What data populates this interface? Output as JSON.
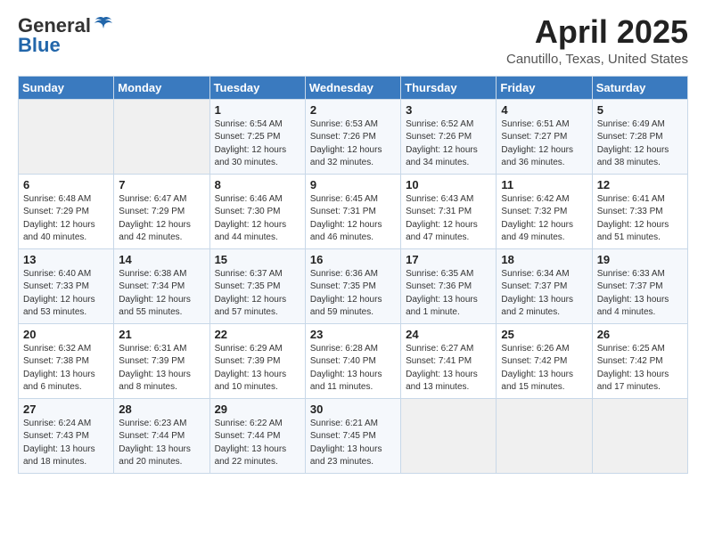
{
  "logo": {
    "line1": "General",
    "line2": "Blue"
  },
  "header": {
    "month": "April 2025",
    "location": "Canutillo, Texas, United States"
  },
  "weekdays": [
    "Sunday",
    "Monday",
    "Tuesday",
    "Wednesday",
    "Thursday",
    "Friday",
    "Saturday"
  ],
  "weeks": [
    [
      {
        "day": "",
        "info": ""
      },
      {
        "day": "",
        "info": ""
      },
      {
        "day": "1",
        "info": "Sunrise: 6:54 AM\nSunset: 7:25 PM\nDaylight: 12 hours and 30 minutes."
      },
      {
        "day": "2",
        "info": "Sunrise: 6:53 AM\nSunset: 7:26 PM\nDaylight: 12 hours and 32 minutes."
      },
      {
        "day": "3",
        "info": "Sunrise: 6:52 AM\nSunset: 7:26 PM\nDaylight: 12 hours and 34 minutes."
      },
      {
        "day": "4",
        "info": "Sunrise: 6:51 AM\nSunset: 7:27 PM\nDaylight: 12 hours and 36 minutes."
      },
      {
        "day": "5",
        "info": "Sunrise: 6:49 AM\nSunset: 7:28 PM\nDaylight: 12 hours and 38 minutes."
      }
    ],
    [
      {
        "day": "6",
        "info": "Sunrise: 6:48 AM\nSunset: 7:29 PM\nDaylight: 12 hours and 40 minutes."
      },
      {
        "day": "7",
        "info": "Sunrise: 6:47 AM\nSunset: 7:29 PM\nDaylight: 12 hours and 42 minutes."
      },
      {
        "day": "8",
        "info": "Sunrise: 6:46 AM\nSunset: 7:30 PM\nDaylight: 12 hours and 44 minutes."
      },
      {
        "day": "9",
        "info": "Sunrise: 6:45 AM\nSunset: 7:31 PM\nDaylight: 12 hours and 46 minutes."
      },
      {
        "day": "10",
        "info": "Sunrise: 6:43 AM\nSunset: 7:31 PM\nDaylight: 12 hours and 47 minutes."
      },
      {
        "day": "11",
        "info": "Sunrise: 6:42 AM\nSunset: 7:32 PM\nDaylight: 12 hours and 49 minutes."
      },
      {
        "day": "12",
        "info": "Sunrise: 6:41 AM\nSunset: 7:33 PM\nDaylight: 12 hours and 51 minutes."
      }
    ],
    [
      {
        "day": "13",
        "info": "Sunrise: 6:40 AM\nSunset: 7:33 PM\nDaylight: 12 hours and 53 minutes."
      },
      {
        "day": "14",
        "info": "Sunrise: 6:38 AM\nSunset: 7:34 PM\nDaylight: 12 hours and 55 minutes."
      },
      {
        "day": "15",
        "info": "Sunrise: 6:37 AM\nSunset: 7:35 PM\nDaylight: 12 hours and 57 minutes."
      },
      {
        "day": "16",
        "info": "Sunrise: 6:36 AM\nSunset: 7:35 PM\nDaylight: 12 hours and 59 minutes."
      },
      {
        "day": "17",
        "info": "Sunrise: 6:35 AM\nSunset: 7:36 PM\nDaylight: 13 hours and 1 minute."
      },
      {
        "day": "18",
        "info": "Sunrise: 6:34 AM\nSunset: 7:37 PM\nDaylight: 13 hours and 2 minutes."
      },
      {
        "day": "19",
        "info": "Sunrise: 6:33 AM\nSunset: 7:37 PM\nDaylight: 13 hours and 4 minutes."
      }
    ],
    [
      {
        "day": "20",
        "info": "Sunrise: 6:32 AM\nSunset: 7:38 PM\nDaylight: 13 hours and 6 minutes."
      },
      {
        "day": "21",
        "info": "Sunrise: 6:31 AM\nSunset: 7:39 PM\nDaylight: 13 hours and 8 minutes."
      },
      {
        "day": "22",
        "info": "Sunrise: 6:29 AM\nSunset: 7:39 PM\nDaylight: 13 hours and 10 minutes."
      },
      {
        "day": "23",
        "info": "Sunrise: 6:28 AM\nSunset: 7:40 PM\nDaylight: 13 hours and 11 minutes."
      },
      {
        "day": "24",
        "info": "Sunrise: 6:27 AM\nSunset: 7:41 PM\nDaylight: 13 hours and 13 minutes."
      },
      {
        "day": "25",
        "info": "Sunrise: 6:26 AM\nSunset: 7:42 PM\nDaylight: 13 hours and 15 minutes."
      },
      {
        "day": "26",
        "info": "Sunrise: 6:25 AM\nSunset: 7:42 PM\nDaylight: 13 hours and 17 minutes."
      }
    ],
    [
      {
        "day": "27",
        "info": "Sunrise: 6:24 AM\nSunset: 7:43 PM\nDaylight: 13 hours and 18 minutes."
      },
      {
        "day": "28",
        "info": "Sunrise: 6:23 AM\nSunset: 7:44 PM\nDaylight: 13 hours and 20 minutes."
      },
      {
        "day": "29",
        "info": "Sunrise: 6:22 AM\nSunset: 7:44 PM\nDaylight: 13 hours and 22 minutes."
      },
      {
        "day": "30",
        "info": "Sunrise: 6:21 AM\nSunset: 7:45 PM\nDaylight: 13 hours and 23 minutes."
      },
      {
        "day": "",
        "info": ""
      },
      {
        "day": "",
        "info": ""
      },
      {
        "day": "",
        "info": ""
      }
    ]
  ]
}
